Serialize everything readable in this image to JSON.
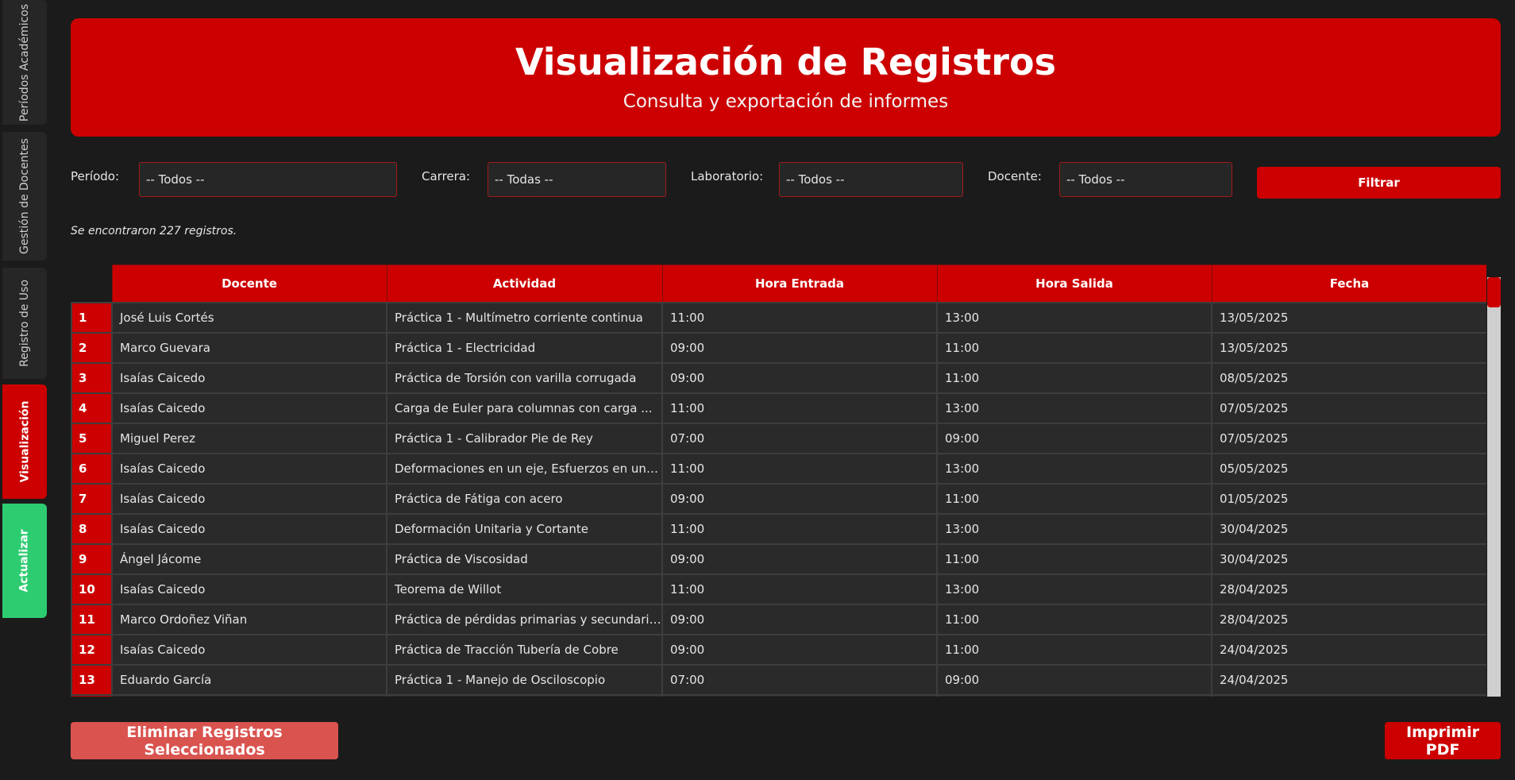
{
  "sidebar": {
    "tabs": [
      {
        "label": "Períodos Académicos"
      },
      {
        "label": "Gestión de Docentes"
      },
      {
        "label": "Registro de Uso"
      },
      {
        "label": "Visualización"
      },
      {
        "label": "Actualizar"
      }
    ]
  },
  "header": {
    "title": "Visualización de Registros",
    "subtitle": "Consulta y exportación de informes"
  },
  "filters": {
    "periodo_label": "Período:",
    "periodo_value": "-- Todos --",
    "carrera_label": "Carrera:",
    "carrera_value": "-- Todas --",
    "laboratorio_label": "Laboratorio:",
    "laboratorio_value": "-- Todos --",
    "docente_label": "Docente:",
    "docente_value": "-- Todos --",
    "filter_button": "Filtrar"
  },
  "results_text": "Se encontraron 227 registros.",
  "colors": {
    "accent": "#cc0000",
    "refresh": "#2ecc71",
    "delete": "#d9534f",
    "background": "#1b1b1b"
  },
  "table": {
    "columns": [
      "Docente",
      "Actividad",
      "Hora Entrada",
      "Hora Salida",
      "Fecha"
    ],
    "rows": [
      {
        "n": "1",
        "docente": "José Luis Cortés",
        "actividad": "Práctica 1 - Multímetro corriente continua",
        "entrada": "11:00",
        "salida": "13:00",
        "fecha": "13/05/2025"
      },
      {
        "n": "2",
        "docente": "Marco Guevara",
        "actividad": "Práctica 1 - Electricidad",
        "entrada": "09:00",
        "salida": "11:00",
        "fecha": "13/05/2025"
      },
      {
        "n": "3",
        "docente": "Isaías Caicedo",
        "actividad": "Práctica de Torsión con varilla corrugada",
        "entrada": "09:00",
        "salida": "11:00",
        "fecha": "08/05/2025"
      },
      {
        "n": "4",
        "docente": "Isaías Caicedo",
        "actividad": "Carga de Euler para columnas con carga ...",
        "entrada": "11:00",
        "salida": "13:00",
        "fecha": "07/05/2025"
      },
      {
        "n": "5",
        "docente": "Miguel Perez",
        "actividad": "Práctica 1 - Calibrador Pie de Rey",
        "entrada": "07:00",
        "salida": "09:00",
        "fecha": "07/05/2025"
      },
      {
        "n": "6",
        "docente": "Isaías Caicedo",
        "actividad": "Deformaciones en un eje, Esfuerzos en un rango",
        "entrada": "11:00",
        "salida": "13:00",
        "fecha": "05/05/2025"
      },
      {
        "n": "7",
        "docente": "Isaías Caicedo",
        "actividad": "Práctica de Fátiga con acero",
        "entrada": "09:00",
        "salida": "11:00",
        "fecha": "01/05/2025"
      },
      {
        "n": "8",
        "docente": "Isaías Caicedo",
        "actividad": "Deformación Unitaria y Cortante",
        "entrada": "11:00",
        "salida": "13:00",
        "fecha": "30/04/2025"
      },
      {
        "n": "9",
        "docente": "Ángel Jácome",
        "actividad": "Práctica de Viscosidad",
        "entrada": "09:00",
        "salida": "11:00",
        "fecha": "30/04/2025"
      },
      {
        "n": "10",
        "docente": "Isaías Caicedo",
        "actividad": "Teorema de Willot",
        "entrada": "11:00",
        "salida": "13:00",
        "fecha": "28/04/2025"
      },
      {
        "n": "11",
        "docente": "Marco Ordoñez Viñan",
        "actividad": "Práctica de pérdidas primarias y secundarias",
        "entrada": "09:00",
        "salida": "11:00",
        "fecha": "28/04/2025"
      },
      {
        "n": "12",
        "docente": "Isaías Caicedo",
        "actividad": "Práctica de Tracción Tubería de Cobre",
        "entrada": "09:00",
        "salida": "11:00",
        "fecha": "24/04/2025"
      },
      {
        "n": "13",
        "docente": "Eduardo García",
        "actividad": "Práctica 1 - Manejo de Osciloscopio",
        "entrada": "07:00",
        "salida": "09:00",
        "fecha": "24/04/2025"
      },
      {
        "n": "",
        "docente": "",
        "actividad": "",
        "entrada": "",
        "salida": "",
        "fecha": ""
      }
    ]
  },
  "buttons": {
    "delete": "Eliminar Registros Seleccionados",
    "pdf": "Imprimir PDF"
  }
}
